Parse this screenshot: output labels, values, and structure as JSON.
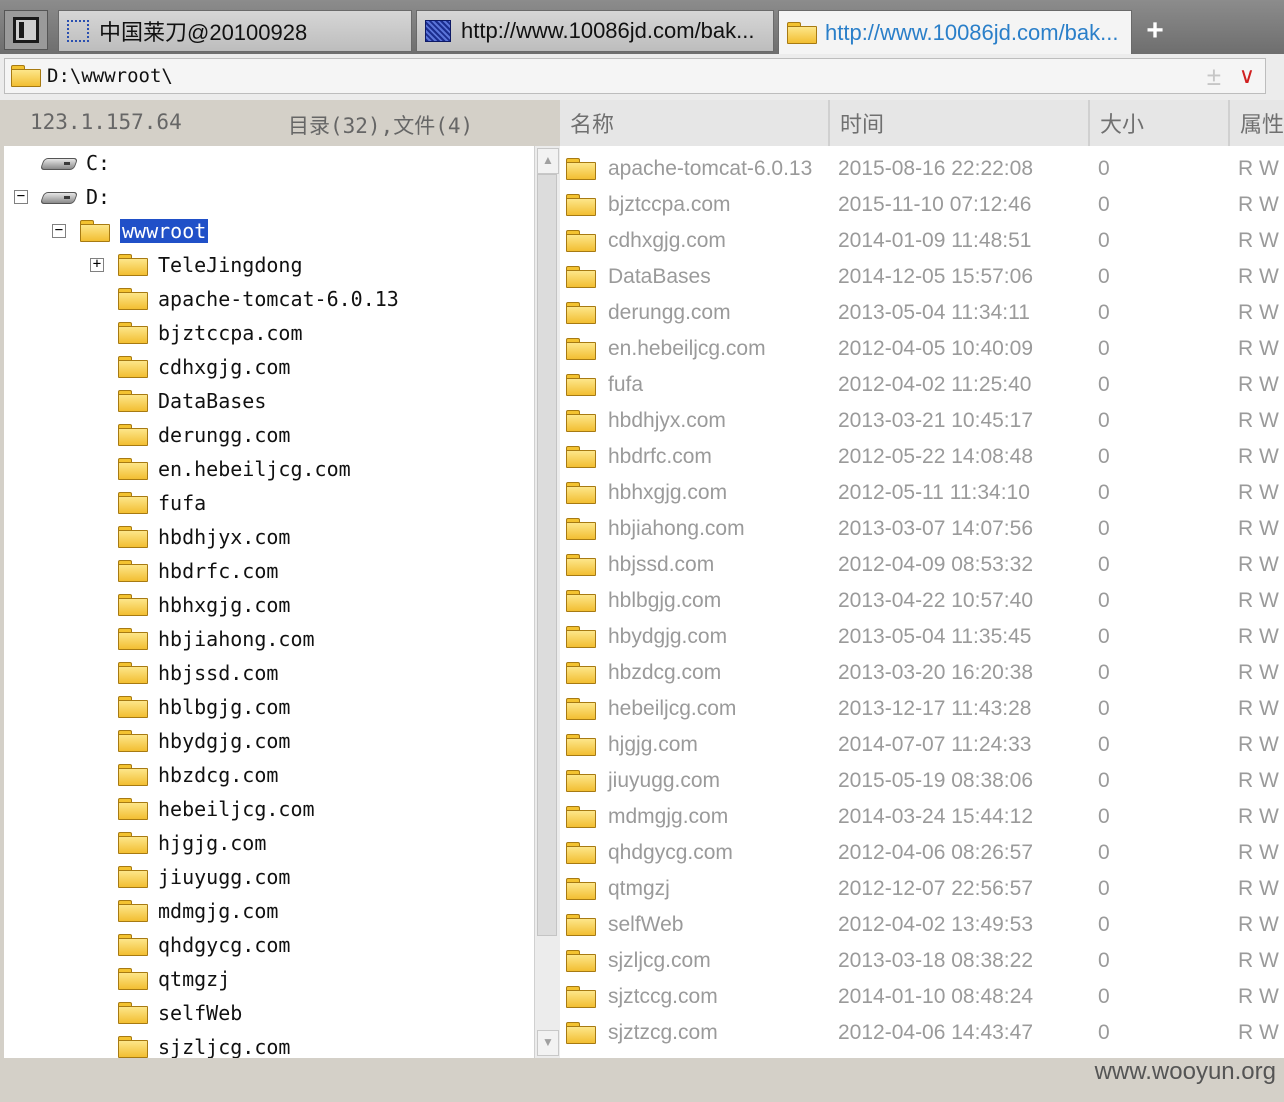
{
  "tabs": [
    {
      "label": "中国莱刀@20100928",
      "icon": "dotted-frame-icon",
      "active": false
    },
    {
      "label": "http://www.10086jd.com/bak...",
      "icon": "page-thumbnail-icon",
      "active": false
    },
    {
      "label": "http://www.10086jd.com/bak...",
      "icon": "folder-icon",
      "active": true
    }
  ],
  "tab_add_label": "+",
  "address": {
    "path": "D:\\wwwroot\\",
    "plus": "±",
    "dropdown": "∨"
  },
  "status": {
    "ip": "123.1.157.64",
    "counts": "目录(32),文件(4)"
  },
  "tree": {
    "drives": [
      {
        "label": "C:",
        "expanded": false
      },
      {
        "label": "D:",
        "expanded": true
      }
    ],
    "selected": "wwwroot",
    "children": [
      {
        "label": "TeleJingdong",
        "expandable": true
      },
      {
        "label": "apache-tomcat-6.0.13"
      },
      {
        "label": "bjztccpa.com"
      },
      {
        "label": "cdhxgjg.com"
      },
      {
        "label": "DataBases"
      },
      {
        "label": "derungg.com"
      },
      {
        "label": "en.hebeiljcg.com"
      },
      {
        "label": "fufa"
      },
      {
        "label": "hbdhjyx.com"
      },
      {
        "label": "hbdrfc.com"
      },
      {
        "label": "hbhxgjg.com"
      },
      {
        "label": "hbjiahong.com"
      },
      {
        "label": "hbjssd.com"
      },
      {
        "label": "hblbgjg.com"
      },
      {
        "label": "hbydgjg.com"
      },
      {
        "label": "hbzdcg.com"
      },
      {
        "label": "hebeiljcg.com"
      },
      {
        "label": "hjgjg.com"
      },
      {
        "label": "jiuyugg.com"
      },
      {
        "label": "mdmgjg.com"
      },
      {
        "label": "qhdgycg.com"
      },
      {
        "label": "qtmgzj"
      },
      {
        "label": "selfWeb"
      },
      {
        "label": "sjzljcg.com"
      }
    ]
  },
  "list": {
    "columns": [
      "名称",
      "时间",
      "大小",
      "属性"
    ],
    "rows": [
      {
        "name": "apache-tomcat-6.0.13",
        "time": "2015-08-16 22:22:08",
        "size": "0",
        "attr": "R W"
      },
      {
        "name": "bjztccpa.com",
        "time": "2015-11-10 07:12:46",
        "size": "0",
        "attr": "R W"
      },
      {
        "name": "cdhxgjg.com",
        "time": "2014-01-09 11:48:51",
        "size": "0",
        "attr": "R W"
      },
      {
        "name": "DataBases",
        "time": "2014-12-05 15:57:06",
        "size": "0",
        "attr": "R W"
      },
      {
        "name": "derungg.com",
        "time": "2013-05-04 11:34:11",
        "size": "0",
        "attr": "R W"
      },
      {
        "name": "en.hebeiljcg.com",
        "time": "2012-04-05 10:40:09",
        "size": "0",
        "attr": "R W"
      },
      {
        "name": "fufa",
        "time": "2012-04-02 11:25:40",
        "size": "0",
        "attr": "R W"
      },
      {
        "name": "hbdhjyx.com",
        "time": "2013-03-21 10:45:17",
        "size": "0",
        "attr": "R W"
      },
      {
        "name": "hbdrfc.com",
        "time": "2012-05-22 14:08:48",
        "size": "0",
        "attr": "R W"
      },
      {
        "name": "hbhxgjg.com",
        "time": "2012-05-11 11:34:10",
        "size": "0",
        "attr": "R W"
      },
      {
        "name": "hbjiahong.com",
        "time": "2013-03-07 14:07:56",
        "size": "0",
        "attr": "R W"
      },
      {
        "name": "hbjssd.com",
        "time": "2012-04-09 08:53:32",
        "size": "0",
        "attr": "R W"
      },
      {
        "name": "hblbgjg.com",
        "time": "2013-04-22 10:57:40",
        "size": "0",
        "attr": "R W"
      },
      {
        "name": "hbydgjg.com",
        "time": "2013-05-04 11:35:45",
        "size": "0",
        "attr": "R W"
      },
      {
        "name": "hbzdcg.com",
        "time": "2013-03-20 16:20:38",
        "size": "0",
        "attr": "R W"
      },
      {
        "name": "hebeiljcg.com",
        "time": "2013-12-17 11:43:28",
        "size": "0",
        "attr": "R W"
      },
      {
        "name": "hjgjg.com",
        "time": "2014-07-07 11:24:33",
        "size": "0",
        "attr": "R W"
      },
      {
        "name": "jiuyugg.com",
        "time": "2015-05-19 08:38:06",
        "size": "0",
        "attr": "R W"
      },
      {
        "name": "mdmgjg.com",
        "time": "2014-03-24 15:44:12",
        "size": "0",
        "attr": "R W"
      },
      {
        "name": "qhdgycg.com",
        "time": "2012-04-06 08:26:57",
        "size": "0",
        "attr": "R W"
      },
      {
        "name": "qtmgzj",
        "time": "2012-12-07 22:56:57",
        "size": "0",
        "attr": "R W"
      },
      {
        "name": "selfWeb",
        "time": "2012-04-02 13:49:53",
        "size": "0",
        "attr": "R W"
      },
      {
        "name": "sjzljcg.com",
        "time": "2013-03-18 08:38:22",
        "size": "0",
        "attr": "R W"
      },
      {
        "name": "sjztccg.com",
        "time": "2014-01-10 08:48:24",
        "size": "0",
        "attr": "R W"
      },
      {
        "name": "sjztzcg.com",
        "time": "2012-04-06 14:43:47",
        "size": "0",
        "attr": "R W"
      }
    ]
  },
  "watermark": "www.wooyun.org",
  "colors": {
    "accent": "#2a7fc9",
    "selection": "#2050c8",
    "folder": "#f2be32"
  }
}
